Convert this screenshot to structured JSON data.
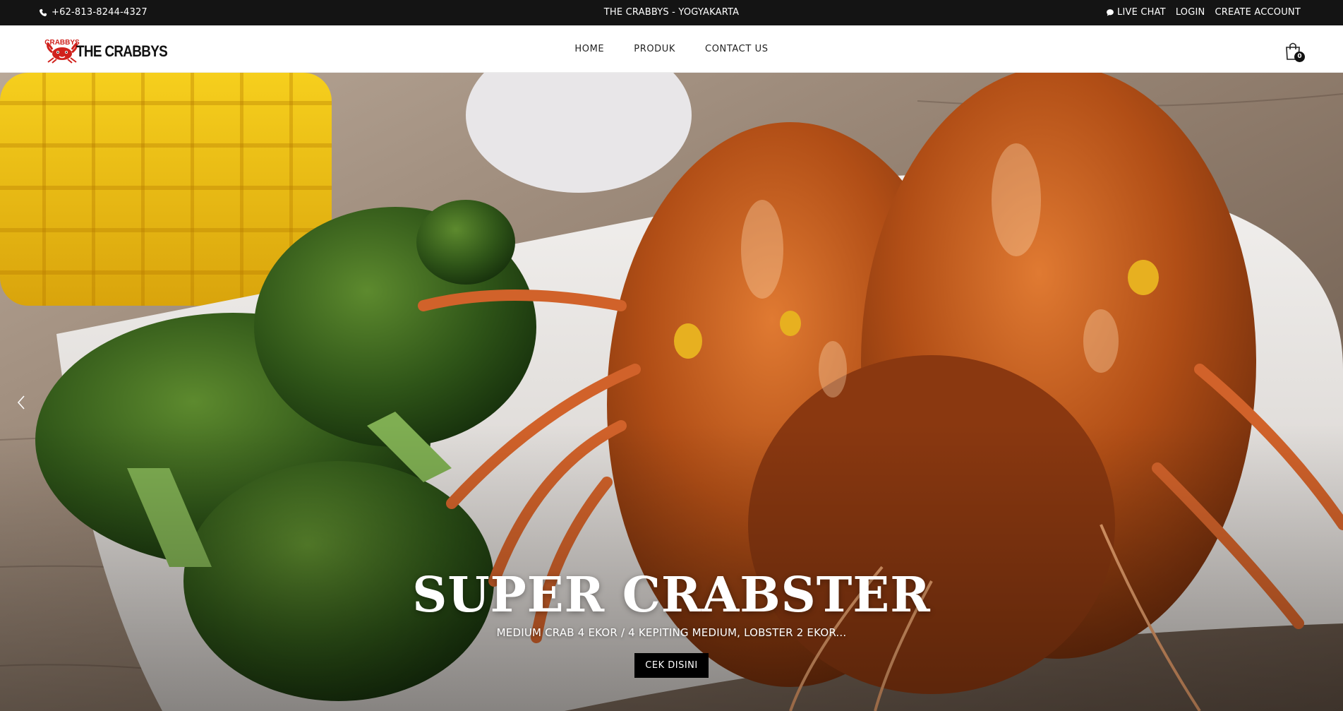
{
  "topbar": {
    "phone": "+62-813-8244-4327",
    "store": "THE CRABBYS - YOGYAKARTA",
    "live_chat": "LIVE CHAT",
    "login": "LOGIN",
    "create_account": "CREATE ACCOUNT"
  },
  "header": {
    "logo_text": "THE CRABBYS",
    "logo_badge": "CRABBYS",
    "nav": [
      "HOME",
      "PRODUK",
      "CONTACT US"
    ],
    "cart_count": "0"
  },
  "hero": {
    "title": "SUPER CRABSTER",
    "subtitle": "MEDIUM CRAB 4 EKOR / 4 KEPITING MEDIUM, LOBSTER 2 EKOR...",
    "button": "CEK DISINI"
  },
  "colors": {
    "topbar_bg": "#141414",
    "accent_red": "#d0211c",
    "button_bg": "#000000"
  },
  "icons": [
    "phone-icon",
    "chat-icon",
    "cart-icon",
    "chevron-left-icon",
    "chevron-right-icon"
  ]
}
